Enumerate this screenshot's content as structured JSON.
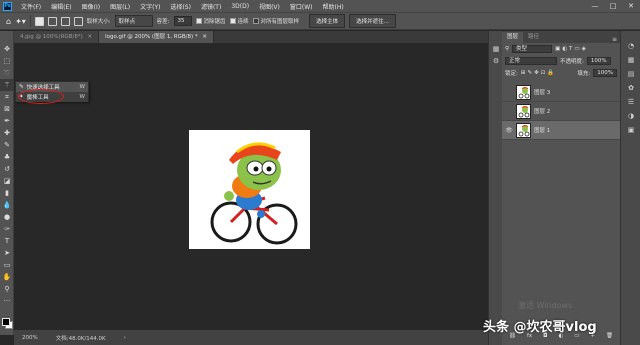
{
  "app": {
    "logo": "Ps"
  },
  "menubar": {
    "items": [
      "文件(F)",
      "编辑(E)",
      "图像(I)",
      "图层(L)",
      "文字(Y)",
      "选择(S)",
      "滤镜(T)",
      "3D(D)",
      "视图(V)",
      "窗口(W)",
      "帮助(H)"
    ],
    "window_controls": [
      "—",
      "□",
      "✕"
    ]
  },
  "options_bar": {
    "sample_size_label": "取样大小:",
    "sample_size_value": "取样点",
    "tolerance_label": "容差:",
    "tolerance_value": "35",
    "antialias_label": "消除锯齿",
    "contiguous_label": "连续",
    "sample_all_label": "对所有图层取样",
    "select_subject_label": "选择主体",
    "select_mask_label": "选择并遮住..."
  },
  "tabs": [
    {
      "label": "4.jpg @ 100%(RGB/8*)",
      "close": "✕",
      "active": false
    },
    {
      "label": "logo.gif @ 200% (图层 1, RGB/8) *",
      "close": "✕",
      "active": true
    }
  ],
  "tool_flyout": {
    "items": [
      {
        "label": "快速选择工具",
        "key": "W",
        "selected": false
      },
      {
        "label": "魔棒工具",
        "key": "W",
        "selected": true
      }
    ]
  },
  "statusbar": {
    "zoom": "200%",
    "doc_info": "文档:48.0K/144.0K",
    "arrow": "›"
  },
  "layers_panel": {
    "tabs": [
      "图层",
      "路径"
    ],
    "kind_label": "类型",
    "blend_mode": "正常",
    "opacity_label": "不透明度:",
    "opacity_value": "100%",
    "lock_label": "锁定:",
    "fill_label": "填充:",
    "fill_value": "100%",
    "layers": [
      {
        "name": "图层 3",
        "visible": false,
        "selected": false
      },
      {
        "name": "图层 2",
        "visible": false,
        "selected": false
      },
      {
        "name": "图层 1",
        "visible": true,
        "selected": true
      }
    ],
    "bottom_icons": [
      "link-icon",
      "fx-icon",
      "mask-icon",
      "adjustment-icon",
      "folder-icon",
      "new-layer-icon",
      "trash-icon"
    ],
    "bottom_glyphs": [
      "⛓",
      "fx",
      "◘",
      "◐",
      "▭",
      "+",
      "🗑"
    ]
  },
  "watermarks": {
    "windows": "激活 Windows",
    "toutiao": "头条 @坎农哥vlog"
  },
  "colors": {
    "accent_red": "#e0201a",
    "panel": "#535353",
    "canvas_bg": "#282828"
  }
}
